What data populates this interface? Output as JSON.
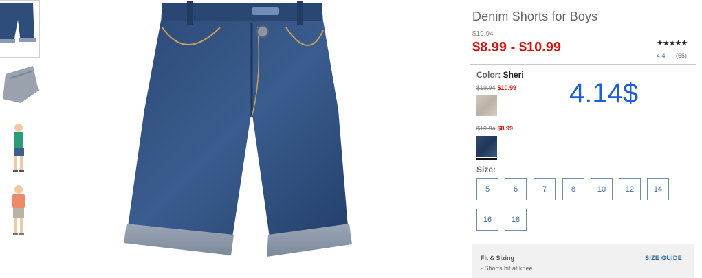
{
  "product": {
    "title": "Denim Shorts for Boys",
    "original_price": "$19.94",
    "price_range": "$8.99 - $10.99",
    "stars": "★★★★★",
    "rating": "4.4",
    "review_count": "(55)"
  },
  "color": {
    "label": "Color:",
    "selected": "Sheri",
    "options": [
      {
        "was": "$19.94",
        "now": "$10.99",
        "swatch": "#c9c1b6"
      },
      {
        "was": "$19.94",
        "now": "$8.99",
        "swatch": "#2a4264"
      }
    ]
  },
  "annotation": {
    "price_overlay": "4.14$"
  },
  "size": {
    "label": "Size:",
    "options": [
      "5",
      "6",
      "7",
      "8",
      "10",
      "12",
      "14",
      "16",
      "18"
    ]
  },
  "fit": {
    "title": "Fit & Sizing",
    "note": "- Shorts hit at knee.",
    "size_guide": "SIZE GUIDE"
  },
  "colors": {
    "sale_red": "#d1160f",
    "link_blue": "#2c6aa0",
    "overlay_blue": "#1b5fd6"
  }
}
